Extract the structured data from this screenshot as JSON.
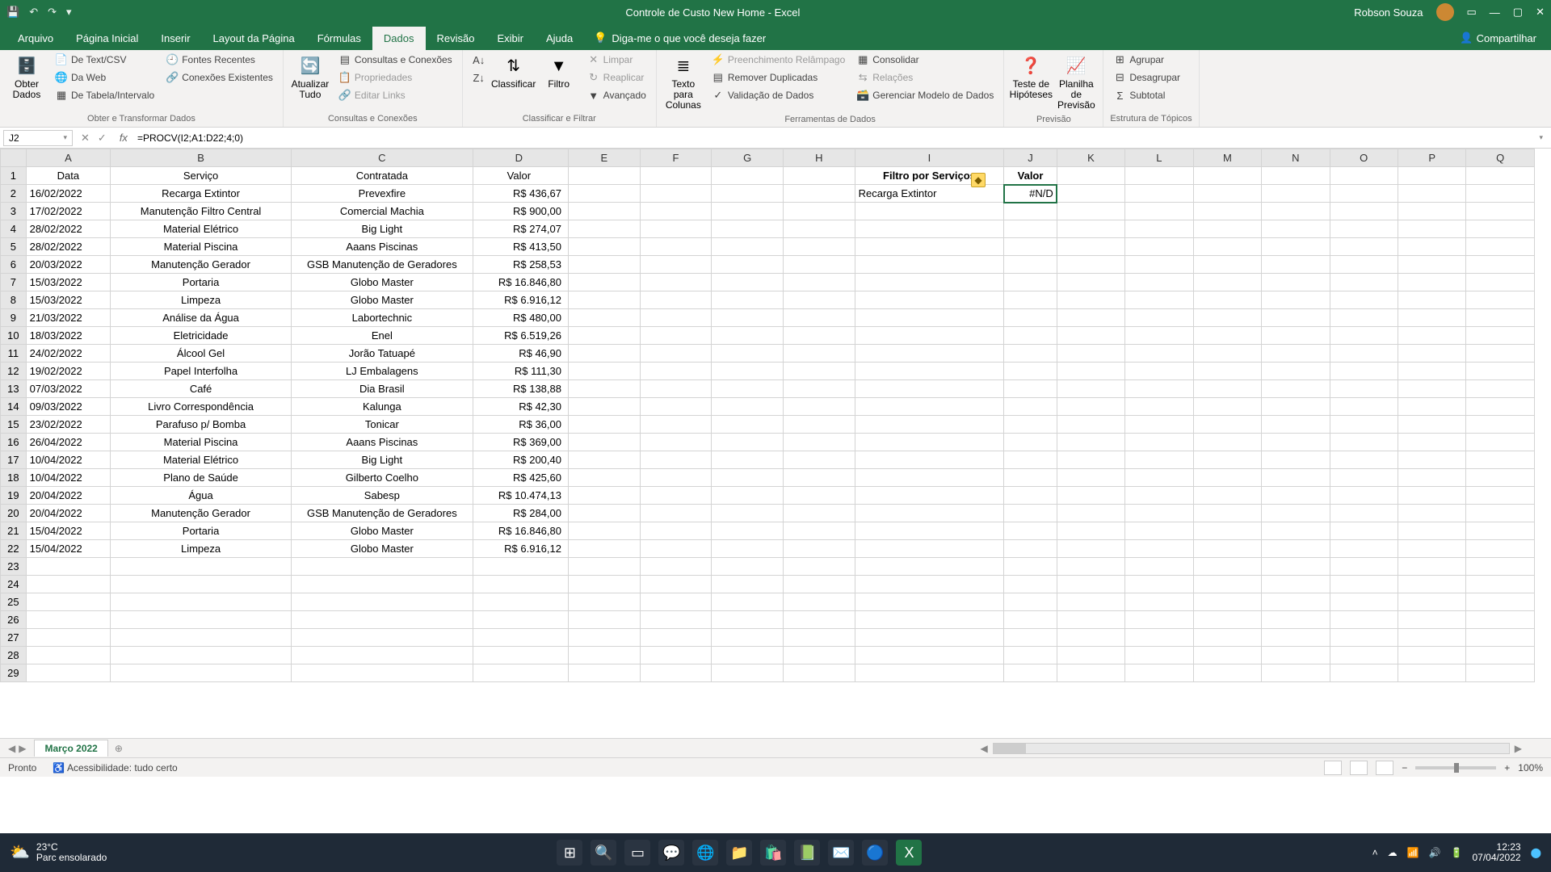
{
  "app": {
    "title": "Controle de Custo New Home  -  Excel",
    "user": "Robson Souza"
  },
  "qat": [
    "save",
    "undo",
    "redo",
    "customize"
  ],
  "tabs": {
    "items": [
      "Arquivo",
      "Página Inicial",
      "Inserir",
      "Layout da Página",
      "Fórmulas",
      "Dados",
      "Revisão",
      "Exibir",
      "Ajuda"
    ],
    "active_index": 5,
    "tell_me": "Diga-me o que você deseja fazer",
    "share": "Compartilhar"
  },
  "ribbon": {
    "groups": [
      {
        "label": "Obter e Transformar Dados",
        "big": "Obter Dados",
        "items": [
          "De Text/CSV",
          "Da Web",
          "De Tabela/Intervalo",
          "Fontes Recentes",
          "Conexões Existentes"
        ]
      },
      {
        "label": "Consultas e Conexões",
        "big": "Atualizar Tudo",
        "items": [
          "Consultas e Conexões",
          "Propriedades",
          "Editar Links"
        ]
      },
      {
        "label": "Classificar e Filtrar",
        "big1": "Classificar",
        "big2": "Filtro",
        "items": [
          "Limpar",
          "Reaplicar",
          "Avançado"
        ]
      },
      {
        "label": "Ferramentas de Dados",
        "big": "Texto para Colunas",
        "items": [
          "Preenchimento Relâmpago",
          "Remover Duplicadas",
          "Validação de Dados",
          "Consolidar",
          "Relações",
          "Gerenciar Modelo de Dados"
        ]
      },
      {
        "label": "Previsão",
        "big1": "Teste de Hipóteses",
        "big2": "Planilha de Previsão"
      },
      {
        "label": "Estrutura de Tópicos",
        "items": [
          "Agrupar",
          "Desagrupar",
          "Subtotal"
        ]
      }
    ]
  },
  "formula_bar": {
    "name_box": "J2",
    "formula": "=PROCV(I2;A1:D22;4;0)"
  },
  "columns": [
    "A",
    "B",
    "C",
    "D",
    "E",
    "F",
    "G",
    "H",
    "I",
    "J",
    "K",
    "L",
    "M",
    "N",
    "O",
    "P",
    "Q"
  ],
  "headers": {
    "A": "Data",
    "B": "Serviço",
    "C": "Contratada",
    "D": "Valor",
    "I": "Filtro por Serviços",
    "J": "Valor"
  },
  "rows": [
    {
      "A": "16/02/2022",
      "B": "Recarga Extintor",
      "C": "Prevexfire",
      "D": "R$ 436,67",
      "I": "Recarga Extintor",
      "J": "#N/D"
    },
    {
      "A": "17/02/2022",
      "B": "Manutenção Filtro Central",
      "C": "Comercial Machia",
      "D": "R$ 900,00"
    },
    {
      "A": "28/02/2022",
      "B": "Material Elétrico",
      "C": "Big Light",
      "D": "R$ 274,07"
    },
    {
      "A": "28/02/2022",
      "B": "Material Piscina",
      "C": "Aaans Piscinas",
      "D": "R$ 413,50"
    },
    {
      "A": "20/03/2022",
      "B": "Manutenção Gerador",
      "C": "GSB Manutenção de Geradores",
      "D": "R$ 258,53"
    },
    {
      "A": "15/03/2022",
      "B": "Portaria",
      "C": "Globo Master",
      "D": "R$ 16.846,80"
    },
    {
      "A": "15/03/2022",
      "B": "Limpeza",
      "C": "Globo Master",
      "D": "R$ 6.916,12"
    },
    {
      "A": "21/03/2022",
      "B": "Análise da Água",
      "C": "Labortechnic",
      "D": "R$ 480,00"
    },
    {
      "A": "18/03/2022",
      "B": "Eletricidade",
      "C": "Enel",
      "D": "R$ 6.519,26"
    },
    {
      "A": "24/02/2022",
      "B": "Álcool Gel",
      "C": "Jorão Tatuapé",
      "D": "R$ 46,90"
    },
    {
      "A": "19/02/2022",
      "B": "Papel Interfolha",
      "C": "LJ Embalagens",
      "D": "R$ 111,30"
    },
    {
      "A": "07/03/2022",
      "B": "Café",
      "C": "Dia Brasil",
      "D": "R$ 138,88"
    },
    {
      "A": "09/03/2022",
      "B": "Livro Correspondência",
      "C": "Kalunga",
      "D": "R$ 42,30"
    },
    {
      "A": "23/02/2022",
      "B": "Parafuso p/ Bomba",
      "C": "Tonicar",
      "D": "R$ 36,00"
    },
    {
      "A": "26/04/2022",
      "B": "Material Piscina",
      "C": "Aaans Piscinas",
      "D": "R$ 369,00"
    },
    {
      "A": "10/04/2022",
      "B": "Material Elétrico",
      "C": "Big Light",
      "D": "R$ 200,40"
    },
    {
      "A": "10/04/2022",
      "B": "Plano de Saúde",
      "C": "Gilberto Coelho",
      "D": "R$ 425,60"
    },
    {
      "A": "20/04/2022",
      "B": "Água",
      "C": "Sabesp",
      "D": "R$ 10.474,13"
    },
    {
      "A": "20/04/2022",
      "B": "Manutenção Gerador",
      "C": "GSB Manutenção de Geradores",
      "D": "R$ 284,00"
    },
    {
      "A": "15/04/2022",
      "B": "Portaria",
      "C": "Globo Master",
      "D": "R$ 16.846,80"
    },
    {
      "A": "15/04/2022",
      "B": "Limpeza",
      "C": "Globo Master",
      "D": "R$ 6.916,12"
    }
  ],
  "empty_rows": [
    23,
    24,
    25,
    26,
    27,
    28,
    29
  ],
  "sheet": {
    "name": "Março 2022"
  },
  "status": {
    "ready": "Pronto",
    "a11y": "Acessibilidade: tudo certo",
    "zoom": "100%"
  },
  "taskbar": {
    "temp": "23°C",
    "weather": "Parc ensolarado",
    "time": "12:23",
    "date": "07/04/2022"
  }
}
